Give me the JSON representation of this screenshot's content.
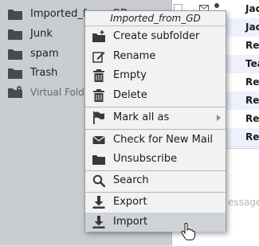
{
  "folders": [
    {
      "label": "Imported_from_GD",
      "icon": "folder-icon"
    },
    {
      "label": "Junk",
      "icon": "folder-icon"
    },
    {
      "label": "spam",
      "icon": "folder-icon"
    },
    {
      "label": "Trash",
      "icon": "folder-icon"
    },
    {
      "label": "Virtual Folde",
      "icon": "virtual-folder-icon"
    }
  ],
  "messages": [
    {
      "from": "Jac"
    },
    {
      "from": "Jac"
    },
    {
      "from": "Res"
    },
    {
      "from": "Tea"
    },
    {
      "from": "Res"
    },
    {
      "from": "Res"
    },
    {
      "from": "Res"
    },
    {
      "from": "Res"
    }
  ],
  "preview": {
    "placeholder": "essage"
  },
  "context_menu": {
    "title": "Imported_from_GD",
    "items": [
      {
        "label": "Create subfolder",
        "icon": "new-folder-icon"
      },
      {
        "label": "Rename",
        "icon": "edit-icon"
      },
      {
        "label": "Empty",
        "icon": "trash-icon"
      },
      {
        "label": "Delete",
        "icon": "trash-icon"
      },
      {
        "label": "Mark all as",
        "icon": "flag-icon",
        "has_submenu": true
      },
      {
        "label": "Check for New Mail",
        "icon": "envelope-icon"
      },
      {
        "label": "Unsubscribe",
        "icon": "folder-icon"
      },
      {
        "label": "Search",
        "icon": "search-icon"
      },
      {
        "label": "Export",
        "icon": "download-icon"
      },
      {
        "label": "Import",
        "icon": "download-icon",
        "highlighted": true
      }
    ]
  },
  "colors": {
    "folder_pane_bg": "#c9ccd0",
    "menu_bg": "#f2f2f2",
    "menu_hover": "#cfd3d8",
    "message_row_alt": "#eef1fb"
  }
}
